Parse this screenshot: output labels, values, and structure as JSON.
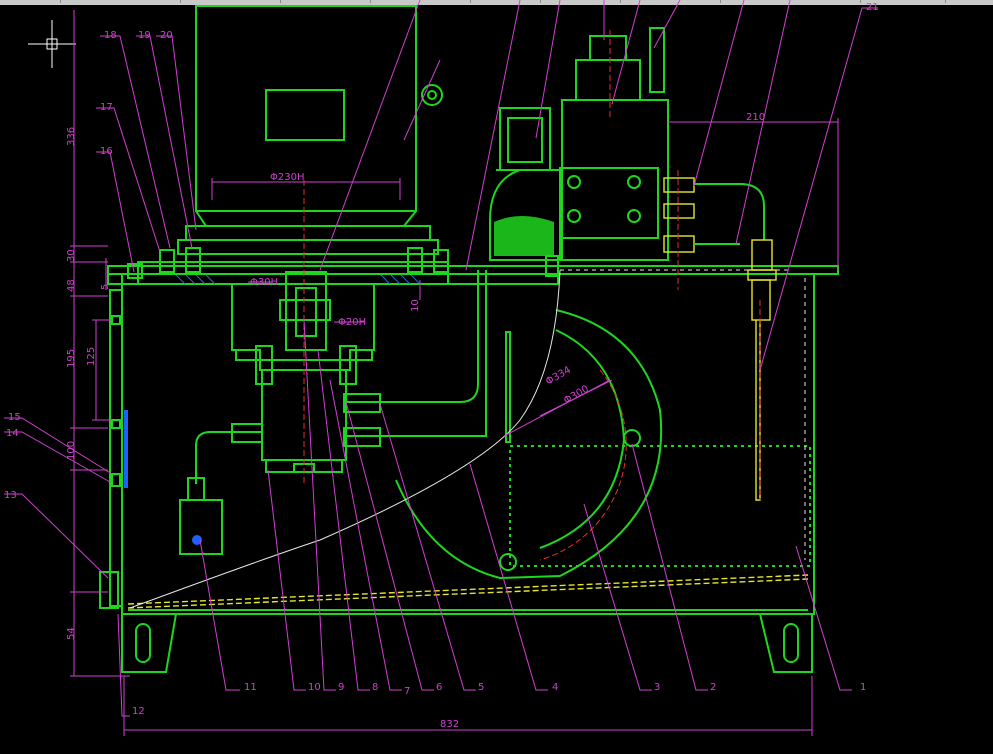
{
  "callouts": [
    "1",
    "2",
    "3",
    "4",
    "5",
    "6",
    "7",
    "8",
    "9",
    "10",
    "11",
    "12",
    "13",
    "14",
    "15",
    "16",
    "17",
    "18",
    "19",
    "20",
    "21"
  ],
  "dimensions": {
    "d230": "Φ230H",
    "d30": "Φ30H",
    "d20": "Φ20H",
    "d334": "Φ334",
    "d300": "Φ300",
    "w210": "210",
    "w832": "832",
    "h336": "336",
    "h30": "30",
    "h48": "48",
    "h195": "195",
    "h125": "125",
    "h100": "100",
    "h54": "54",
    "h5": "5",
    "h10": "10"
  },
  "colors": {
    "outline": "#1fd61f",
    "leader": "#d13fd1",
    "centerline": "#e03030",
    "fitting": "#e6e62a",
    "background": "#000000"
  }
}
